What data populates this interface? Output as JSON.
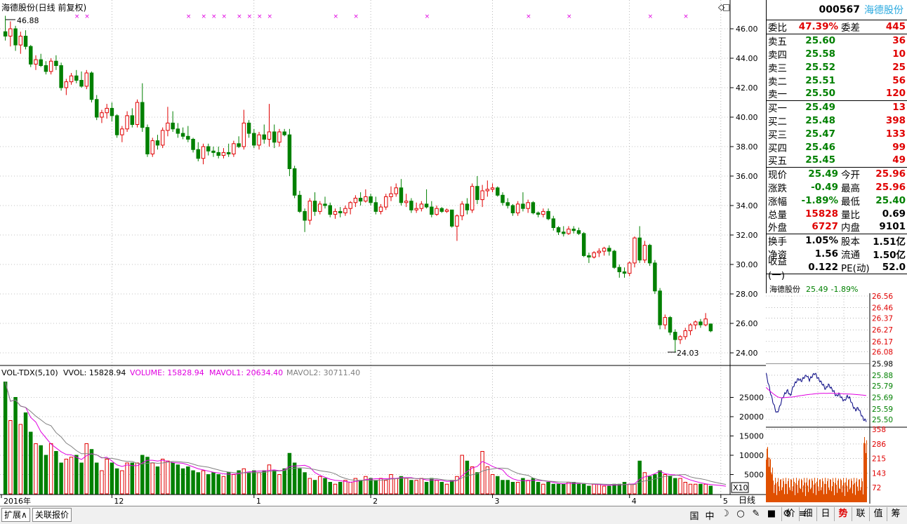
{
  "chart_title": "海德股份(日线 前复权)",
  "price_high_label": "46.88",
  "price_low_label": "24.03",
  "price_axis": [
    "46.00",
    "44.00",
    "42.00",
    "40.00",
    "38.00",
    "36.00",
    "34.00",
    "32.00",
    "30.00",
    "28.00",
    "26.00",
    "24.00"
  ],
  "volume_header": {
    "name": "VOL-TDX(5,10)",
    "vvol": "VVOL: 15828.94",
    "volume": "VOLUME: 15828.94",
    "mavol1": "MAVOL1: 20634.40",
    "mavol2": "MAVOL2: 30711.40"
  },
  "volume_axis": [
    "25000",
    "20000",
    "15000",
    "10000",
    "5000"
  ],
  "x10_label": "X10",
  "date_axis": [
    "2016年",
    "12",
    "1",
    "2",
    "3",
    "4",
    "5"
  ],
  "period_label": "日线",
  "colors": {
    "up": "#e00000",
    "down": "#008000",
    "ma1": "#e000e0",
    "ma2": "#808080",
    "grid": "#888888"
  },
  "quote": {
    "code": "000567",
    "name": "海德股份",
    "weibi_label": "委比",
    "weibi": "47.39%",
    "weicha_label": "委差",
    "weicha": "445",
    "sells": [
      {
        "label": "卖五",
        "price": "25.60",
        "vol": "36"
      },
      {
        "label": "卖四",
        "price": "25.58",
        "vol": "10"
      },
      {
        "label": "卖三",
        "price": "25.52",
        "vol": "25"
      },
      {
        "label": "卖二",
        "price": "25.51",
        "vol": "56"
      },
      {
        "label": "卖一",
        "price": "25.50",
        "vol": "120"
      }
    ],
    "buys": [
      {
        "label": "买一",
        "price": "25.49",
        "vol": "13"
      },
      {
        "label": "买二",
        "price": "25.48",
        "vol": "398"
      },
      {
        "label": "买三",
        "price": "25.47",
        "vol": "133"
      },
      {
        "label": "买四",
        "price": "25.46",
        "vol": "99"
      },
      {
        "label": "买五",
        "price": "25.45",
        "vol": "49"
      }
    ],
    "stats": [
      {
        "l1": "现价",
        "v1": "25.49",
        "c1": "grn",
        "l2": "今开",
        "v2": "25.96",
        "c2": "red"
      },
      {
        "l1": "涨跌",
        "v1": "-0.49",
        "c1": "grn",
        "l2": "最高",
        "v2": "25.96",
        "c2": "red"
      },
      {
        "l1": "涨幅",
        "v1": "-1.89%",
        "c1": "grn",
        "l2": "最低",
        "v2": "25.40",
        "c2": "grn"
      },
      {
        "l1": "总量",
        "v1": "15828",
        "c1": "red",
        "l2": "量比",
        "v2": "0.69",
        "c2": "blk"
      },
      {
        "l1": "外盘",
        "v1": "6727",
        "c1": "red",
        "l2": "内盘",
        "v2": "9101",
        "c2": "blk"
      }
    ],
    "fund": [
      {
        "l1": "换手",
        "v1": "1.05%",
        "l2": "股本",
        "v2": "1.51亿"
      },
      {
        "l1": "净资",
        "v1": "1.56",
        "l2": "流通",
        "v2": "1.50亿"
      },
      {
        "l1": "收益(一)",
        "v1": "0.122",
        "l2": "PE(动)",
        "v2": "52.0"
      }
    ]
  },
  "mini": {
    "name": "海德股份",
    "price": "25.49",
    "pct": "-1.89%",
    "price_axis": [
      "26.56",
      "26.46",
      "26.37",
      "26.27",
      "26.17",
      "26.08",
      "25.98",
      "25.88",
      "25.79",
      "25.69",
      "25.59",
      "25.50"
    ],
    "vol_axis": [
      "358",
      "286",
      "215",
      "143",
      "72"
    ]
  },
  "bottom": {
    "tab1": "扩展∧",
    "tab2": "关联报价",
    "right_tabs": [
      "价",
      "细",
      "日",
      "势",
      "联",
      "值",
      "筹"
    ],
    "active_tab": "势",
    "tools": [
      "国",
      "中",
      "☽",
      "○",
      "✎",
      "■",
      "⚙",
      "≡"
    ]
  },
  "chart_data": {
    "type": "candlestick",
    "ohlc": [
      [
        45.8,
        46.88,
        45.2,
        45.5
      ],
      [
        45.5,
        46.5,
        44.8,
        46.0
      ],
      [
        46.0,
        46.2,
        44.5,
        44.9
      ],
      [
        44.9,
        45.8,
        44.3,
        45.5
      ],
      [
        45.5,
        45.9,
        44.6,
        44.8
      ],
      [
        44.8,
        44.9,
        43.4,
        43.6
      ],
      [
        43.6,
        44.2,
        43.2,
        43.9
      ],
      [
        43.9,
        44.3,
        43.4,
        43.5
      ],
      [
        43.5,
        43.8,
        42.9,
        43.1
      ],
      [
        43.1,
        44.0,
        42.9,
        43.8
      ],
      [
        43.8,
        44.2,
        43.2,
        43.5
      ],
      [
        43.5,
        43.7,
        41.8,
        42.0
      ],
      [
        42.0,
        42.6,
        41.5,
        42.4
      ],
      [
        42.4,
        43.0,
        42.2,
        42.8
      ],
      [
        42.8,
        43.2,
        42.3,
        42.5
      ],
      [
        42.5,
        43.1,
        42.0,
        42.1
      ],
      [
        42.1,
        43.2,
        41.9,
        43.0
      ],
      [
        43.0,
        43.1,
        41.0,
        41.2
      ],
      [
        41.2,
        41.5,
        39.8,
        40.0
      ],
      [
        40.0,
        40.5,
        39.6,
        40.3
      ],
      [
        40.3,
        40.9,
        39.9,
        40.6
      ],
      [
        40.6,
        41.0,
        39.7,
        40.1
      ],
      [
        40.1,
        40.2,
        38.6,
        38.8
      ],
      [
        38.8,
        39.4,
        38.3,
        39.2
      ],
      [
        39.2,
        40.4,
        39.0,
        40.1
      ],
      [
        40.1,
        40.6,
        39.3,
        39.5
      ],
      [
        39.5,
        41.2,
        39.3,
        41.0
      ],
      [
        41.0,
        42.3,
        39.0,
        39.3
      ],
      [
        39.3,
        39.5,
        37.3,
        37.5
      ],
      [
        37.5,
        38.6,
        37.3,
        38.4
      ],
      [
        38.4,
        38.8,
        37.8,
        38.1
      ],
      [
        38.1,
        39.3,
        37.9,
        39.1
      ],
      [
        39.1,
        40.7,
        38.7,
        39.6
      ],
      [
        39.6,
        40.4,
        39.0,
        39.2
      ],
      [
        39.2,
        39.6,
        38.6,
        38.9
      ],
      [
        38.9,
        39.3,
        38.5,
        38.7
      ],
      [
        38.7,
        39.4,
        38.3,
        38.5
      ],
      [
        38.5,
        38.6,
        37.6,
        37.8
      ],
      [
        37.8,
        38.3,
        37.0,
        37.2
      ],
      [
        37.2,
        38.2,
        36.8,
        38.0
      ],
      [
        38.0,
        38.2,
        37.4,
        37.7
      ],
      [
        37.7,
        38.0,
        37.3,
        37.6
      ],
      [
        37.6,
        38.0,
        37.2,
        37.4
      ],
      [
        37.4,
        37.9,
        37.2,
        37.6
      ],
      [
        37.6,
        38.2,
        37.3,
        37.5
      ],
      [
        37.5,
        38.4,
        37.3,
        38.2
      ],
      [
        38.2,
        38.7,
        37.9,
        38.0
      ],
      [
        38.0,
        40.5,
        37.8,
        39.6
      ],
      [
        39.6,
        39.8,
        38.6,
        38.9
      ],
      [
        38.9,
        39.2,
        37.9,
        38.1
      ],
      [
        38.1,
        39.0,
        37.8,
        38.8
      ],
      [
        38.8,
        39.5,
        38.2,
        38.5
      ],
      [
        38.5,
        40.9,
        38.0,
        39.0
      ],
      [
        39.0,
        39.5,
        37.9,
        38.3
      ],
      [
        38.3,
        39.2,
        38.0,
        39.0
      ],
      [
        39.0,
        39.2,
        38.7,
        38.8
      ],
      [
        38.8,
        39.2,
        36.0,
        36.5
      ],
      [
        36.5,
        36.7,
        34.5,
        34.7
      ],
      [
        34.7,
        35.0,
        33.5,
        33.6
      ],
      [
        33.6,
        33.8,
        32.2,
        33.0
      ],
      [
        33.0,
        34.5,
        32.7,
        34.3
      ],
      [
        34.3,
        34.9,
        33.3,
        33.6
      ],
      [
        33.6,
        34.3,
        33.4,
        34.1
      ],
      [
        34.1,
        34.6,
        33.8,
        34.0
      ],
      [
        34.0,
        34.2,
        33.2,
        33.4
      ],
      [
        33.4,
        33.8,
        33.1,
        33.6
      ],
      [
        33.6,
        33.9,
        33.2,
        33.5
      ],
      [
        33.5,
        34.0,
        33.3,
        33.8
      ],
      [
        33.8,
        34.3,
        33.4,
        34.2
      ],
      [
        34.2,
        34.7,
        33.9,
        34.5
      ],
      [
        34.5,
        34.9,
        34.0,
        34.3
      ],
      [
        34.3,
        35.1,
        34.2,
        34.6
      ],
      [
        34.6,
        34.8,
        34.0,
        34.2
      ],
      [
        34.2,
        34.6,
        33.4,
        33.6
      ],
      [
        33.6,
        34.1,
        33.4,
        33.9
      ],
      [
        33.9,
        34.8,
        33.7,
        34.6
      ],
      [
        34.6,
        35.3,
        34.3,
        34.8
      ],
      [
        34.8,
        35.5,
        34.6,
        35.2
      ],
      [
        35.2,
        35.8,
        34.0,
        34.2
      ],
      [
        34.2,
        34.8,
        33.9,
        34.3
      ],
      [
        34.3,
        34.5,
        33.5,
        33.7
      ],
      [
        33.7,
        34.2,
        33.5,
        33.8
      ],
      [
        33.8,
        34.3,
        33.6,
        34.1
      ],
      [
        34.1,
        35.1,
        33.8,
        33.9
      ],
      [
        33.9,
        34.3,
        33.2,
        33.4
      ],
      [
        33.4,
        34.0,
        33.3,
        33.8
      ],
      [
        33.8,
        33.9,
        33.5,
        33.6
      ],
      [
        33.6,
        33.8,
        33.5,
        33.7
      ],
      [
        33.7,
        33.7,
        32.5,
        32.6
      ],
      [
        32.6,
        33.4,
        31.6,
        33.3
      ],
      [
        33.3,
        34.3,
        33.0,
        34.1
      ],
      [
        34.1,
        34.5,
        33.4,
        33.7
      ],
      [
        33.7,
        35.5,
        33.5,
        35.3
      ],
      [
        35.3,
        36.0,
        34.1,
        34.4
      ],
      [
        34.4,
        35.4,
        33.9,
        35.0
      ],
      [
        35.0,
        35.7,
        34.6,
        35.1
      ],
      [
        35.1,
        35.5,
        34.9,
        35.2
      ],
      [
        35.2,
        35.3,
        34.6,
        34.7
      ],
      [
        34.7,
        34.9,
        34.0,
        34.2
      ],
      [
        34.2,
        34.5,
        33.8,
        34.0
      ],
      [
        34.0,
        34.1,
        33.3,
        33.5
      ],
      [
        33.5,
        34.3,
        33.3,
        34.1
      ],
      [
        34.1,
        34.9,
        33.6,
        33.8
      ],
      [
        33.8,
        34.4,
        33.5,
        34.2
      ],
      [
        34.2,
        34.3,
        33.4,
        33.5
      ],
      [
        33.5,
        33.6,
        33.2,
        33.4
      ],
      [
        33.4,
        33.8,
        33.2,
        33.6
      ],
      [
        33.6,
        33.8,
        33.0,
        33.1
      ],
      [
        33.1,
        33.3,
        32.3,
        32.5
      ],
      [
        32.5,
        32.6,
        32.0,
        32.2
      ],
      [
        32.2,
        32.6,
        31.9,
        32.1
      ],
      [
        32.1,
        32.6,
        32.0,
        32.4
      ],
      [
        32.4,
        32.6,
        32.1,
        32.3
      ],
      [
        32.3,
        32.5,
        32.0,
        32.1
      ],
      [
        32.1,
        32.2,
        30.5,
        30.6
      ],
      [
        30.6,
        30.8,
        30.1,
        30.5
      ],
      [
        30.5,
        30.9,
        30.4,
        30.8
      ],
      [
        30.8,
        31.1,
        30.5,
        30.9
      ],
      [
        30.9,
        31.2,
        30.6,
        31.1
      ],
      [
        31.1,
        31.3,
        30.6,
        30.9
      ],
      [
        30.9,
        31.0,
        29.7,
        29.8
      ],
      [
        29.8,
        30.0,
        29.1,
        29.5
      ],
      [
        29.5,
        29.8,
        29.1,
        29.4
      ],
      [
        29.4,
        30.2,
        29.2,
        30.1
      ],
      [
        30.1,
        31.9,
        29.8,
        31.8
      ],
      [
        31.8,
        32.6,
        30.1,
        30.3
      ],
      [
        30.3,
        31.6,
        30.1,
        31.3
      ],
      [
        31.3,
        31.4,
        29.9,
        30.1
      ],
      [
        30.1,
        30.3,
        28.0,
        28.2
      ],
      [
        28.2,
        28.4,
        25.6,
        25.9
      ],
      [
        25.9,
        26.6,
        25.6,
        26.4
      ],
      [
        26.4,
        26.5,
        25.2,
        25.4
      ],
      [
        25.4,
        25.6,
        24.03,
        24.9
      ],
      [
        24.9,
        25.2,
        24.6,
        25.1
      ],
      [
        25.1,
        25.7,
        24.9,
        25.5
      ],
      [
        25.5,
        26.0,
        25.2,
        25.9
      ],
      [
        25.9,
        26.2,
        25.6,
        26.1
      ],
      [
        26.1,
        26.3,
        25.7,
        25.9
      ],
      [
        25.9,
        26.7,
        25.8,
        26.3
      ],
      [
        25.96,
        25.96,
        25.4,
        25.49
      ]
    ],
    "volume": [
      29000,
      19000,
      25000,
      18000,
      21000,
      16000,
      13000,
      12500,
      10000,
      13000,
      11000,
      8000,
      9000,
      9500,
      10000,
      8000,
      13000,
      11500,
      8000,
      6000,
      9000,
      8000,
      6500,
      6000,
      8000,
      8000,
      8000,
      10000,
      9500,
      8000,
      7000,
      9000,
      8500,
      8000,
      7500,
      6500,
      7000,
      6000,
      5500,
      6000,
      5000,
      5500,
      5000,
      4500,
      5500,
      5000,
      6000,
      6500,
      5500,
      6000,
      5500,
      6000,
      7500,
      6000,
      5000,
      6500,
      10500,
      8000,
      6500,
      5500,
      4000,
      3500,
      4500,
      4000,
      3000,
      2500,
      3000,
      3500,
      3000,
      4000,
      3500,
      4500,
      4000,
      3500,
      4000,
      3500,
      5000,
      4000,
      4500,
      4000,
      3500,
      3500,
      4000,
      3000,
      4000,
      3500,
      3000,
      2500,
      3500,
      4500,
      10000,
      8500,
      7000,
      5500,
      11000,
      7000,
      5000,
      4500,
      3500,
      3500,
      3000,
      3000,
      4000,
      3500,
      4000,
      3000,
      2500,
      3000,
      2500,
      2500,
      2500,
      3000,
      3000,
      2500,
      2500,
      2000,
      2500,
      2500,
      2000,
      2000,
      2500,
      2500,
      3000,
      2500,
      2500,
      8500,
      5500,
      4500,
      5000,
      6000,
      5000,
      4500,
      4000,
      4000,
      3000,
      2500,
      2500,
      2500,
      2500,
      2000,
      2000,
      1800,
      1600
    ],
    "price_range": [
      23.5,
      47.0
    ],
    "volume_range": [
      0,
      30000
    ],
    "x_ticks": [
      "2016年",
      "12",
      "1",
      "2",
      "3",
      "4",
      "5"
    ]
  }
}
